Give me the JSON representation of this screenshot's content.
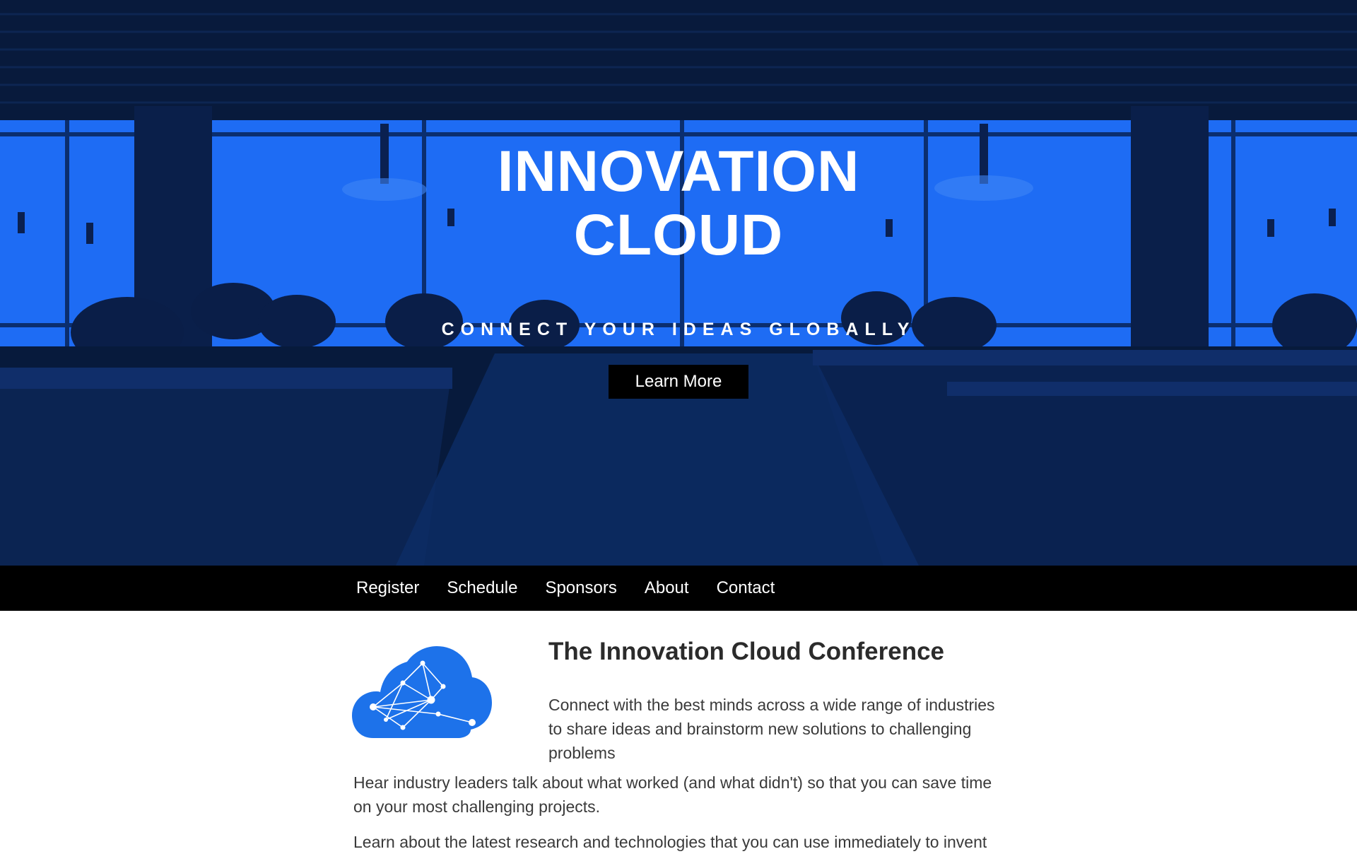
{
  "hero": {
    "title_line1": "INNOVATION",
    "title_line2": "CLOUD",
    "tagline": "CONNECT YOUR IDEAS GLOBALLY",
    "button_label": "Learn More"
  },
  "nav": {
    "items": [
      {
        "label": "Register"
      },
      {
        "label": "Schedule"
      },
      {
        "label": "Sponsors"
      },
      {
        "label": "About"
      },
      {
        "label": "Contact"
      }
    ]
  },
  "main": {
    "logo_icon": "cloud-network-icon",
    "title": "The Innovation Cloud Conference",
    "intro": "Connect with the best minds across a wide range of industries to share ideas and brainstorm new solutions to challenging problems",
    "paragraphs": [
      "Hear industry leaders talk about what worked (and what didn't) so that you can save time on your most challenging projects.",
      "Learn about the latest research and technologies that you can use immediately to invent"
    ]
  },
  "colors": {
    "hero_blue": "#1e6cf4",
    "hero_dark": "#061838",
    "nav_bg": "#000000",
    "logo_blue": "#1d72ea",
    "text": "#3a3a3a"
  }
}
